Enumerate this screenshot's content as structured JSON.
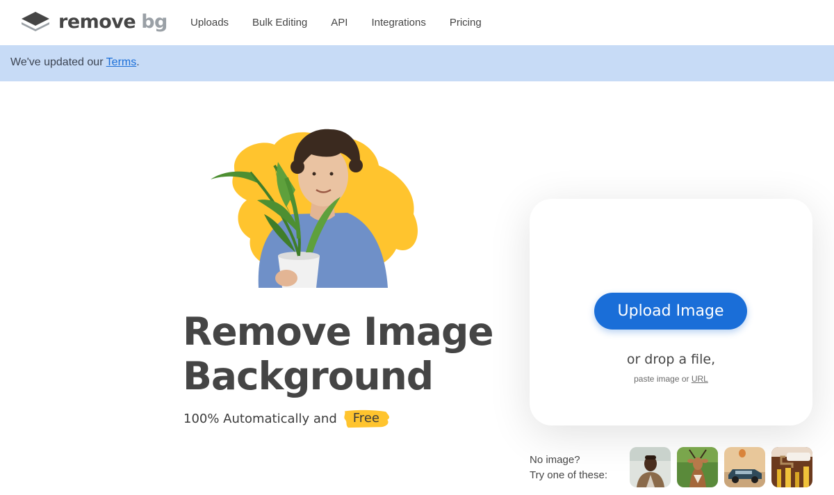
{
  "header": {
    "logo": {
      "word1": "remove",
      "word2": "bg",
      "icon": "layers-icon"
    },
    "nav": [
      "Uploads",
      "Bulk Editing",
      "API",
      "Integrations",
      "Pricing"
    ]
  },
  "banner": {
    "prefix": "We've updated our ",
    "link": "Terms",
    "suffix": "."
  },
  "hero": {
    "headline_line1": "Remove Image",
    "headline_line2": "Background",
    "subline": "100% Automatically and",
    "free_badge": "Free",
    "image": "person-holding-plant-photo"
  },
  "upload": {
    "button_label": "Upload Image",
    "drop_text": "or drop a file,",
    "paste_prefix": "paste image or ",
    "paste_link": "URL"
  },
  "samples": {
    "line1": "No image?",
    "line2": "Try one of these:",
    "thumbnails": [
      "person-photo",
      "antelope-photo",
      "car-photo",
      "paint-roller-photo"
    ]
  },
  "colors": {
    "accent": "#1a6ed8",
    "banner": "#c7dbf6",
    "highlight": "#ffc42e",
    "text": "#454545"
  }
}
